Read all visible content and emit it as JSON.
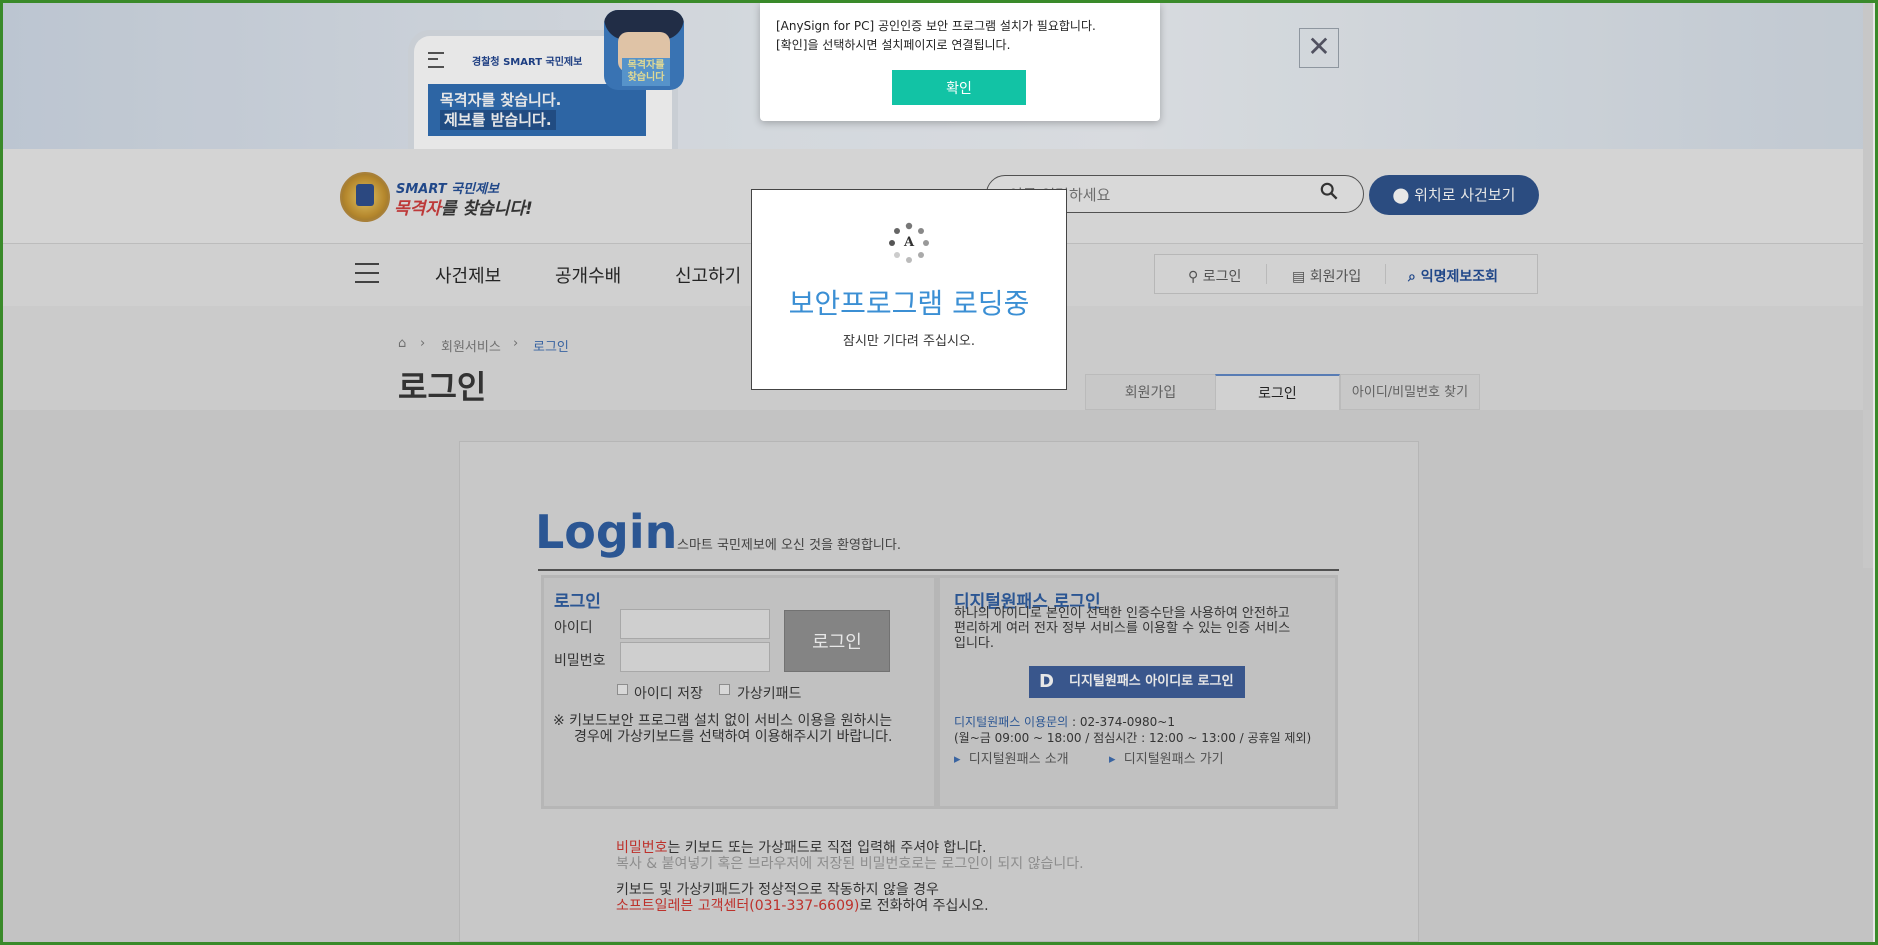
{
  "banner": {
    "phone_logo": "경찰청 SMART 국민제보",
    "phone_card_line1": "목격자를 찾습니다.",
    "phone_card_line2": "제보를 받습니다.",
    "icon_text": "목격자를 찾습니다",
    "close_symbol": "✕"
  },
  "alert": {
    "line1": "[AnySign for PC] 공인인증 보안 프로그램 설치가 필요합니다.",
    "line2": "[확인]을 선택하시면 설치페이지로 연결됩니다.",
    "ok_label": "확인"
  },
  "header": {
    "logo_top": "SMART 국민제보",
    "logo_red": "목격자",
    "logo_rest": "를 찾습니다!",
    "search_placeholder": "어를 입력하세요",
    "location_button": "위치로 사건보기"
  },
  "nav": {
    "items": [
      "사건제보",
      "공개수배",
      "신고하기"
    ],
    "util": [
      {
        "label": "로그인"
      },
      {
        "label": "회원가입"
      },
      {
        "label": "익명제보조회"
      }
    ]
  },
  "breadcrumb": {
    "level1": "회원서비스",
    "level2": "로그인"
  },
  "page_title": "로그인",
  "tabs": [
    "회원가입",
    "로그인",
    "아이디/비밀번호 찾기"
  ],
  "login": {
    "heading": "Login",
    "welcome": "스마트 국민제보에 오신 것을 환영합니다.",
    "panel_title": "로그인",
    "id_label": "아이디",
    "pw_label": "비밀번호",
    "button": "로그인",
    "save_id": "아이디 저장",
    "virtual_keypad": "가상키패드",
    "note_line1": "※ 키보드보안 프로그램 설치 없이 서비스 이용을 원하시는",
    "note_line2": "경우에 가상키보드를 선택하여 이용해주시기 바랍니다."
  },
  "digital": {
    "title": "디지털원패스 로그인",
    "desc1": "하나의 아이디로 본인이 선택한 인증수단을 사용하여 안전하고",
    "desc2": "편리하게 여러 전자 정부 서비스를 이용할 수 있는 인증 서비스",
    "desc3": "입니다.",
    "button_letter": "D",
    "button": "디지털원패스 아이디로 로그인",
    "inquiry_label": "디지털원패스 이용문의",
    "inquiry_phone": " : 02-374-0980~1",
    "hours": "(월~금 09:00 ~ 18:00 / 점심시간 : 12:00 ~ 13:00 / 공휴일 제외)",
    "link1": "디지털원패스 소개",
    "link2": "디지털원패스 가기"
  },
  "notices": {
    "pw_word": "비밀번호",
    "pw_rest": "는 키보드 또는 가상패드로 직접 입력해 주셔야 합니다.",
    "pw_line2": "복사 & 붙여넣기 혹은 브라우저에 저장된 비밀번호로는 로그인이 되지 않습니다.",
    "kb_line1": "키보드 및 가상키패드가 정상적으로 작동하지 않을 경우",
    "kb_red": "소프트일레븐 고객센터(031-337-6609)",
    "kb_rest": "로 전화하여 주십시오."
  },
  "loading": {
    "spinner_letter": "A",
    "title": "보안프로그램 로딩중",
    "sub": "잠시만 기다려 주십시오."
  },
  "colors": {
    "brand_blue": "#2a5aa0",
    "ok_teal": "#12c3a5",
    "loading_blue": "#3b8fd4",
    "notice_red": "#d0302a"
  }
}
